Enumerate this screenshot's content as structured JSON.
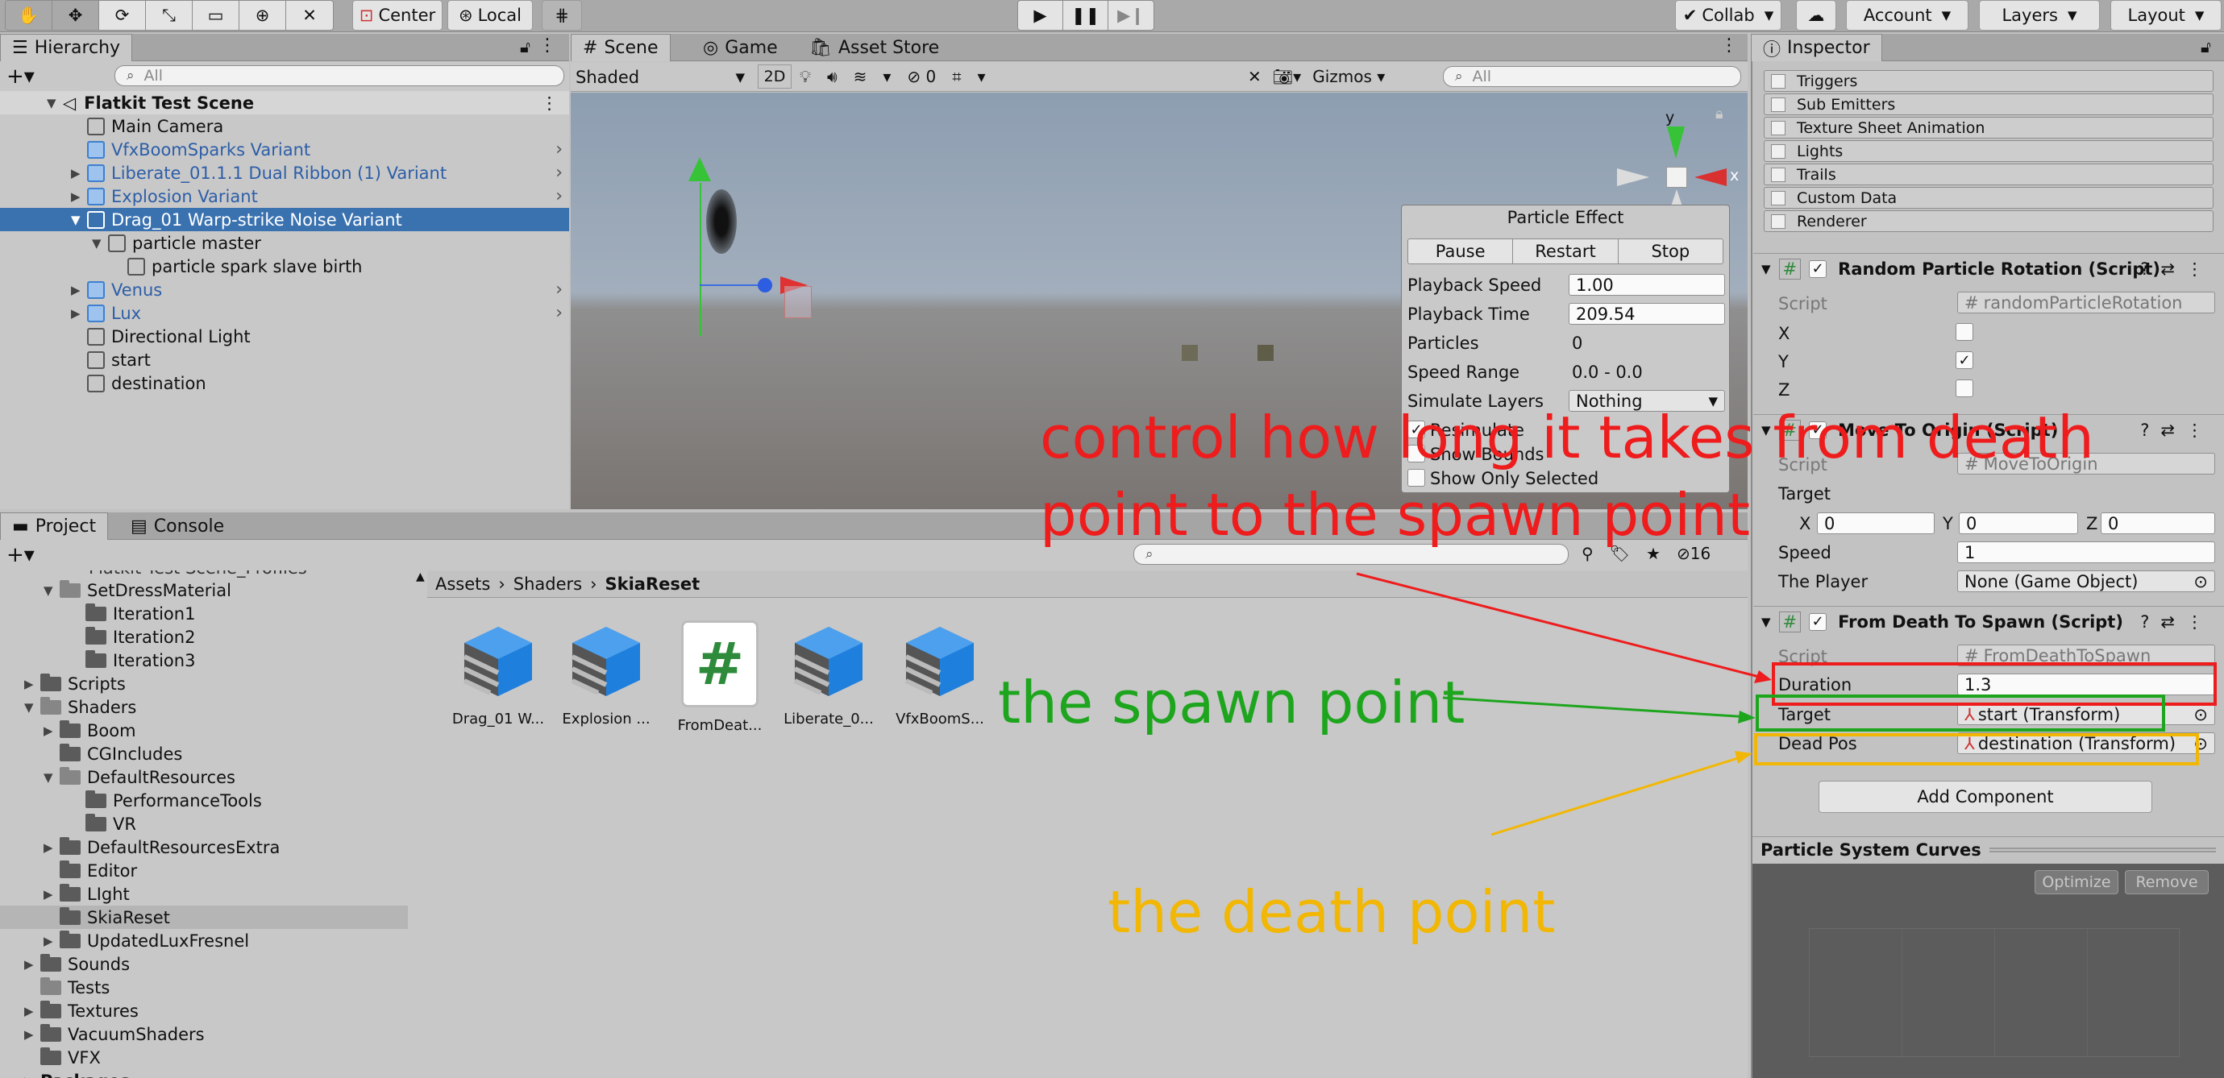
{
  "toolbar": {
    "center_label": "Center",
    "local_label": "Local",
    "collab_label": "Collab",
    "account_label": "Account",
    "layers_label": "Layers",
    "layout_label": "Layout"
  },
  "hierarchy": {
    "tab_label": "Hierarchy",
    "search_placeholder": "All",
    "scene_name": "Flatkit Test Scene",
    "items": [
      {
        "label": "Main Camera"
      },
      {
        "label": "VfxBoomSparks Variant"
      },
      {
        "label": "Liberate_01.1.1 Dual Ribbon (1) Variant"
      },
      {
        "label": "Explosion Variant"
      },
      {
        "label": "Drag_01 Warp-strike Noise Variant"
      },
      {
        "label": "particle master"
      },
      {
        "label": "particle spark slave birth"
      },
      {
        "label": "Venus"
      },
      {
        "label": "Lux"
      },
      {
        "label": "Directional Light"
      },
      {
        "label": "start"
      },
      {
        "label": "destination"
      }
    ]
  },
  "scene_view": {
    "tabs": [
      "Scene",
      "Game",
      "Asset Store"
    ],
    "shading_mode": "Shaded",
    "mode_2d": "2D",
    "hidden_count": "0",
    "gizmos_label": "Gizmos",
    "search_placeholder": "All",
    "axis_y": "y",
    "axis_x": "x"
  },
  "particle_effect": {
    "title": "Particle Effect",
    "buttons": [
      "Pause",
      "Restart",
      "Stop"
    ],
    "playback_speed_label": "Playback Speed",
    "playback_speed": "1.00",
    "playback_time_label": "Playback Time",
    "playback_time": "209.54",
    "particles_label": "Particles",
    "particles": "0",
    "speed_range_label": "Speed Range",
    "speed_range": "0.0 - 0.0",
    "simulate_layers_label": "Simulate Layers",
    "simulate_layers": "Nothing",
    "resimulate_label": "Resimulate",
    "show_bounds_label": "Show Bounds",
    "show_only_selected_label": "Show Only Selected"
  },
  "project": {
    "tabs": [
      "Project",
      "Console"
    ],
    "hidden_count": "16",
    "tree_top_clipped": "Flatkit Test Scene_Profiles",
    "tree": [
      {
        "label": "SetDressMaterial"
      },
      {
        "label": "Iteration1"
      },
      {
        "label": "Iteration2"
      },
      {
        "label": "Iteration3"
      },
      {
        "label": "Scripts"
      },
      {
        "label": "Shaders"
      },
      {
        "label": "Boom"
      },
      {
        "label": "CGIncludes"
      },
      {
        "label": "DefaultResources"
      },
      {
        "label": "PerformanceTools"
      },
      {
        "label": "VR"
      },
      {
        "label": "DefaultResourcesExtra"
      },
      {
        "label": "Editor"
      },
      {
        "label": "LIght"
      },
      {
        "label": "SkiaReset"
      },
      {
        "label": "UpdatedLuxFresnel"
      },
      {
        "label": "Sounds"
      },
      {
        "label": "Tests"
      },
      {
        "label": "Textures"
      },
      {
        "label": "VacuumShaders"
      },
      {
        "label": "VFX"
      },
      {
        "label": "Packages"
      }
    ],
    "breadcrumb": [
      "Assets",
      "Shaders",
      "SkiaReset"
    ],
    "assets": [
      {
        "label": "Drag_01 W..."
      },
      {
        "label": "Explosion ..."
      },
      {
        "label": "FromDeat..."
      },
      {
        "label": "Liberate_0..."
      },
      {
        "label": "VfxBoomS..."
      }
    ]
  },
  "inspector": {
    "tab_label": "Inspector",
    "modules": [
      "Triggers",
      "Sub Emitters",
      "Texture Sheet Animation",
      "Lights",
      "Trails",
      "Custom Data",
      "Renderer"
    ],
    "random_rotation": {
      "title": "Random Particle Rotation (Script)",
      "script_label": "Script",
      "script_value": "randomParticleRotation",
      "x_label": "X",
      "y_label": "Y",
      "z_label": "Z"
    },
    "move_to_origin": {
      "title": "Move To Origin (Script)",
      "script_label": "Script",
      "script_value": "MoveToOrigin",
      "target_label": "Target",
      "tx_label": "X",
      "tx": "0",
      "ty_label": "Y",
      "ty": "0",
      "tz_label": "Z",
      "tz": "0",
      "speed_label": "Speed",
      "speed": "1",
      "player_label": "The Player",
      "player": "None (Game Object)"
    },
    "from_death": {
      "title": "From Death To Spawn (Script)",
      "script_label": "Script",
      "script_value": "FromDeathToSpawn",
      "duration_label": "Duration",
      "duration": "1.3",
      "target_label": "Target",
      "target": "start (Transform)",
      "dead_label": "Dead Pos",
      "dead": "destination (Transform)"
    },
    "add_component": "Add Component",
    "curves_title": "Particle System Curves",
    "optimize": "Optimize",
    "remove": "Remove"
  },
  "annotations": {
    "red_line1": "control how long it takes from death",
    "red_line2": "point to the spawn point",
    "green": "the spawn point",
    "yellow": "the death point",
    "red_color": "#ee1c1c",
    "green_color": "#1ea51e",
    "yellow_color": "#f2b705"
  }
}
